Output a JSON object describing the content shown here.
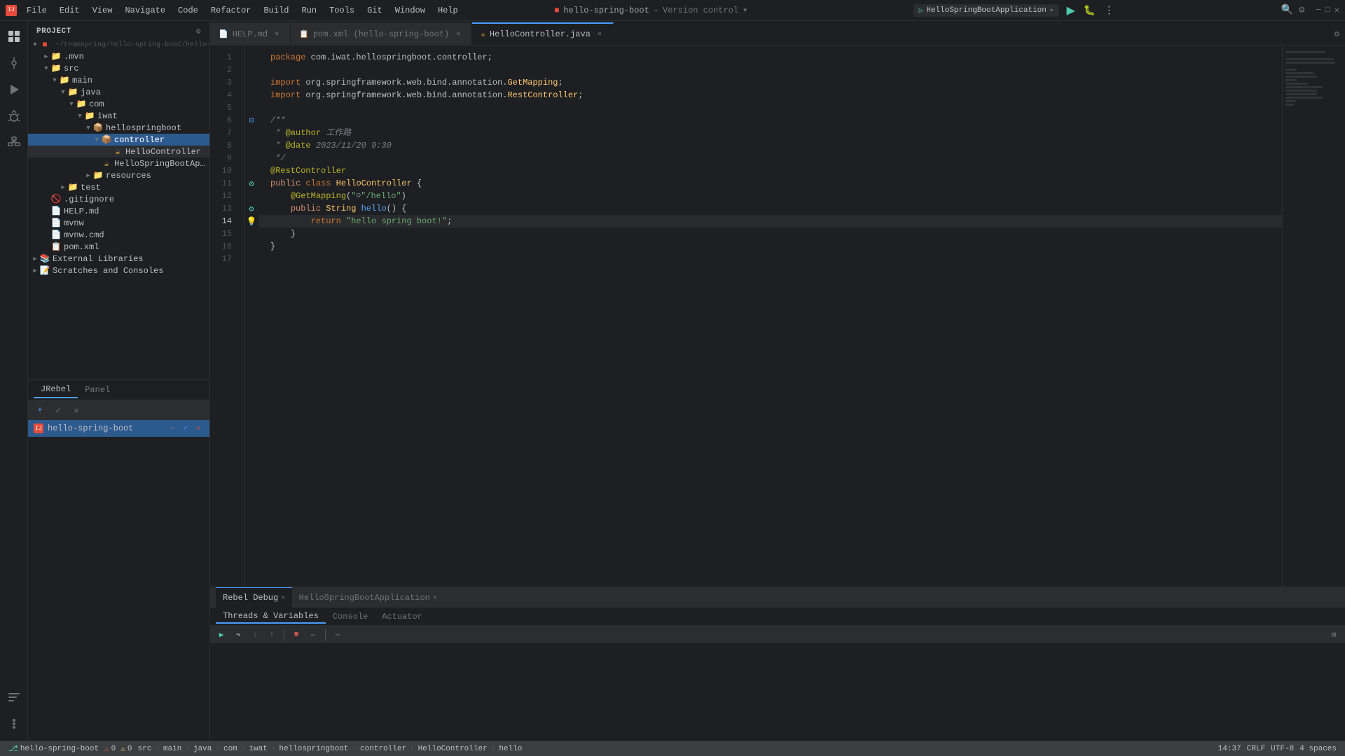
{
  "app": {
    "title": "hello-spring-boot",
    "version_control": "Version control"
  },
  "menu": {
    "items": [
      "File",
      "Edit",
      "View",
      "Navigate",
      "Code",
      "Refactor",
      "Build",
      "Run",
      "Tools",
      "Git",
      "Window",
      "Help"
    ]
  },
  "titlebar": {
    "project": "hello-spring-boot",
    "run_config": "HelloSpringBootApplication"
  },
  "sidebar": {
    "header": "Project",
    "tree": [
      {
        "id": "hello-spring-boot",
        "label": "hello-spring-boot",
        "level": 0,
        "type": "project",
        "expanded": true
      },
      {
        "id": "m-mvn",
        "label": ".mvn",
        "level": 1,
        "type": "folder",
        "expanded": false
      },
      {
        "id": "src",
        "label": "src",
        "level": 1,
        "type": "folder",
        "expanded": true
      },
      {
        "id": "main",
        "label": "main",
        "level": 2,
        "type": "folder",
        "expanded": true
      },
      {
        "id": "java",
        "label": "java",
        "level": 3,
        "type": "folder",
        "expanded": true
      },
      {
        "id": "com",
        "label": "com",
        "level": 4,
        "type": "folder",
        "expanded": true
      },
      {
        "id": "iwat",
        "label": "iwat",
        "level": 5,
        "type": "folder",
        "expanded": true
      },
      {
        "id": "hellospringboot",
        "label": "hellospringboot",
        "level": 6,
        "type": "package",
        "expanded": true
      },
      {
        "id": "controller",
        "label": "controller",
        "level": 7,
        "type": "package",
        "expanded": true,
        "selected": true
      },
      {
        "id": "HelloController",
        "label": "HelloController",
        "level": 8,
        "type": "java",
        "selected": false
      },
      {
        "id": "HelloSpringBootApplication",
        "label": "HelloSpringBootApplication",
        "level": 7,
        "type": "java"
      },
      {
        "id": "resources",
        "label": "resources",
        "level": 6,
        "type": "folder",
        "expanded": false
      },
      {
        "id": "test",
        "label": "test",
        "level": 3,
        "type": "folder",
        "expanded": false
      },
      {
        "id": "gitignore",
        "label": ".gitignore",
        "level": 1,
        "type": "file"
      },
      {
        "id": "HELP-md",
        "label": "HELP.md",
        "level": 1,
        "type": "md"
      },
      {
        "id": "mvn",
        "label": "mvnw",
        "level": 1,
        "type": "file"
      },
      {
        "id": "mvnw-cmd",
        "label": "mvnw.cmd",
        "level": 1,
        "type": "file"
      },
      {
        "id": "pom-xml",
        "label": "pom.xml",
        "level": 1,
        "type": "xml"
      },
      {
        "id": "external-libs",
        "label": "External Libraries",
        "level": 0,
        "type": "libs"
      },
      {
        "id": "scratches",
        "label": "Scratches and Consoles",
        "level": 0,
        "type": "scratches"
      }
    ]
  },
  "tabs": {
    "items": [
      {
        "id": "help-md",
        "label": "HELP.md",
        "icon": "📄",
        "active": false,
        "modified": false
      },
      {
        "id": "pom-xml",
        "label": "pom.xml (hello-spring-boot)",
        "icon": "📄",
        "active": false,
        "modified": false
      },
      {
        "id": "hello-controller",
        "label": "HelloController.java",
        "icon": "☕",
        "active": true,
        "modified": false
      }
    ]
  },
  "editor": {
    "filename": "HelloController.java",
    "lines": [
      {
        "num": 1,
        "content": "package com.iwat.hellospringboot.controller;"
      },
      {
        "num": 2,
        "content": ""
      },
      {
        "num": 3,
        "content": "import org.springframework.web.bind.annotation.GetMapping;"
      },
      {
        "num": 4,
        "content": "import org.springframework.web.bind.annotation.RestController;"
      },
      {
        "num": 5,
        "content": ""
      },
      {
        "num": 6,
        "content": "/**"
      },
      {
        "num": 7,
        "content": " * @author 工作路"
      },
      {
        "num": 8,
        "content": " * @date 2023/11/20 9:30"
      },
      {
        "num": 9,
        "content": " */"
      },
      {
        "num": 10,
        "content": "@RestController"
      },
      {
        "num": 11,
        "content": "public class HelloController {"
      },
      {
        "num": 12,
        "content": "    @GetMapping(\"/hello\")"
      },
      {
        "num": 13,
        "content": "    public String hello() {"
      },
      {
        "num": 14,
        "content": "        return \"hello spring boot!\";"
      },
      {
        "num": 15,
        "content": "    }"
      },
      {
        "num": 16,
        "content": "}"
      },
      {
        "num": 17,
        "content": ""
      }
    ]
  },
  "rebel_panel": {
    "tabs": [
      {
        "id": "jrebel",
        "label": "JRebel",
        "active": true
      },
      {
        "id": "panel",
        "label": "Panel",
        "active": false
      }
    ],
    "project_row": "hello-spring-boot"
  },
  "bottom": {
    "tabs": [
      {
        "id": "rebel-debug",
        "label": "Rebel Debug",
        "active": true
      },
      {
        "id": "hello-app",
        "label": "HelloSpringBootApplication",
        "active": false
      }
    ],
    "subtabs": [
      {
        "id": "threads",
        "label": "Threads & Variables",
        "active": true
      },
      {
        "id": "console",
        "label": "Console",
        "active": false
      },
      {
        "id": "actuator",
        "label": "Actuator",
        "active": false
      }
    ]
  },
  "status_bar": {
    "git": "hello-spring-boot",
    "path": "src › main › java › com › iwat › hellospringboot › controller › HelloController › hello",
    "position": "14:37",
    "line_sep": "CRLF",
    "encoding": "UTF-8",
    "indent": "4 spaces"
  }
}
